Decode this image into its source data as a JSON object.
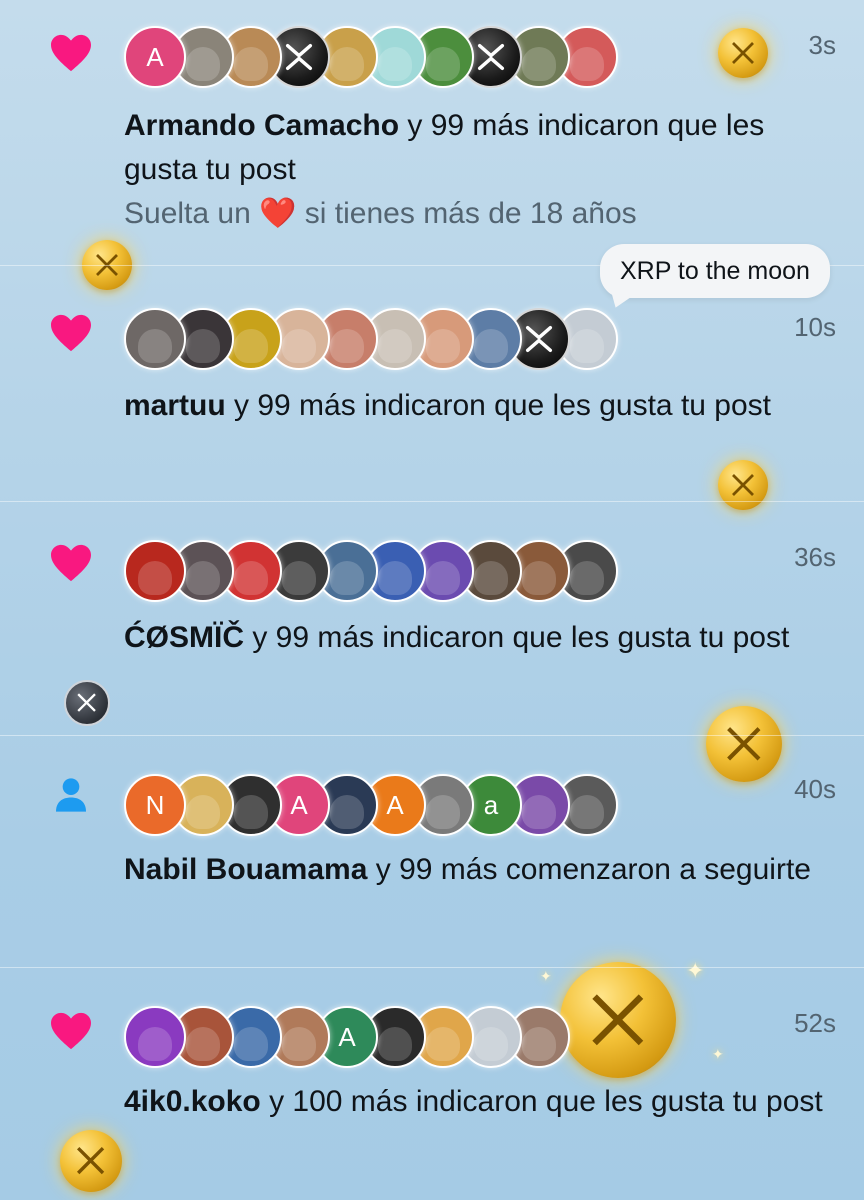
{
  "colors": {
    "heart": "#f91880",
    "follow": "#1d9bf0",
    "muted": "#536471",
    "text": "#0f1419"
  },
  "notifications": [
    {
      "type": "like",
      "icon": "heart-icon",
      "time": "3s",
      "user": "Armando Camacho",
      "rest": " y 99 más indicaron que les gusta tu post",
      "preview_before": "Suelta un ",
      "preview_emoji": "❤️",
      "preview_after": " si tienes más de 18 años",
      "avatars": [
        {
          "letter": "A",
          "color": "#e0457b"
        },
        {
          "letter": "",
          "color": "#8a8479"
        },
        {
          "letter": "",
          "color": "#b98a56"
        },
        {
          "letter": "",
          "color": "x"
        },
        {
          "letter": "",
          "color": "#c9a04a"
        },
        {
          "letter": "",
          "color": "#9fd9d8"
        },
        {
          "letter": "",
          "color": "#4c8e3d"
        },
        {
          "letter": "",
          "color": "x"
        },
        {
          "letter": "",
          "color": "#6f7a56"
        },
        {
          "letter": "",
          "color": "#d45a5a"
        }
      ]
    },
    {
      "type": "like",
      "icon": "heart-icon",
      "time": "10s",
      "user": "martuu",
      "rest": " y 99 más indicaron que les gusta tu post",
      "avatars": [
        {
          "letter": "",
          "color": "#6e6866"
        },
        {
          "letter": "",
          "color": "#3a3538"
        },
        {
          "letter": "",
          "color": "#c8a21a"
        },
        {
          "letter": "",
          "color": "#d8b49a"
        },
        {
          "letter": "",
          "color": "#c77e6a"
        },
        {
          "letter": "",
          "color": "#c8bfb4"
        },
        {
          "letter": "",
          "color": "#d79a7a"
        },
        {
          "letter": "",
          "color": "#5d7da6"
        },
        {
          "letter": "",
          "color": "x"
        },
        {
          "letter": "",
          "color": "#c4ccd4"
        }
      ]
    },
    {
      "type": "like",
      "icon": "heart-icon",
      "time": "36s",
      "user": "ĆØSMÏČ",
      "rest": " y 99 más indicaron que les gusta tu post",
      "avatars": [
        {
          "letter": "",
          "color": "#b8281e"
        },
        {
          "letter": "",
          "color": "#5c5256"
        },
        {
          "letter": "",
          "color": "#d13333"
        },
        {
          "letter": "",
          "color": "#3b3b3b"
        },
        {
          "letter": "",
          "color": "#4a6f96"
        },
        {
          "letter": "",
          "color": "#3a5fb3"
        },
        {
          "letter": "",
          "color": "#6b4bb0"
        },
        {
          "letter": "",
          "color": "#5a4a3c"
        },
        {
          "letter": "",
          "color": "#8a5a3a"
        },
        {
          "letter": "",
          "color": "#4a4a4a"
        }
      ]
    },
    {
      "type": "follow",
      "icon": "person-icon",
      "time": "40s",
      "user": "Nabil Bouamama",
      "rest": " y 99 más comenzaron a seguirte",
      "avatars": [
        {
          "letter": "N",
          "color": "#ea6a2a"
        },
        {
          "letter": "",
          "color": "#d8b25a"
        },
        {
          "letter": "",
          "color": "#2f2f2f"
        },
        {
          "letter": "A",
          "color": "#e0457b"
        },
        {
          "letter": "",
          "color": "#2a3a55"
        },
        {
          "letter": "A",
          "color": "#ea7a1a"
        },
        {
          "letter": "",
          "color": "#7a7a7a"
        },
        {
          "letter": "a",
          "color": "#3d8a3a"
        },
        {
          "letter": "",
          "color": "#7a4aa8"
        },
        {
          "letter": "",
          "color": "#5a5a5a"
        }
      ]
    },
    {
      "type": "like",
      "icon": "heart-icon",
      "time": "52s",
      "user": "4ik0.koko",
      "rest": " y 100 más indicaron que les gusta tu post",
      "avatars": [
        {
          "letter": "",
          "color": "#8a3ac0"
        },
        {
          "letter": "",
          "color": "#a8543a"
        },
        {
          "letter": "",
          "color": "#3a6aa8"
        },
        {
          "letter": "",
          "color": "#b07a5a"
        },
        {
          "letter": "A",
          "color": "#2e8a5a"
        },
        {
          "letter": "",
          "color": "#2a2a2a"
        },
        {
          "letter": "",
          "color": "#e0a64a"
        },
        {
          "letter": "",
          "color": "#c4ccd4"
        },
        {
          "letter": "",
          "color": "#9a7a6a"
        }
      ]
    }
  ]
}
